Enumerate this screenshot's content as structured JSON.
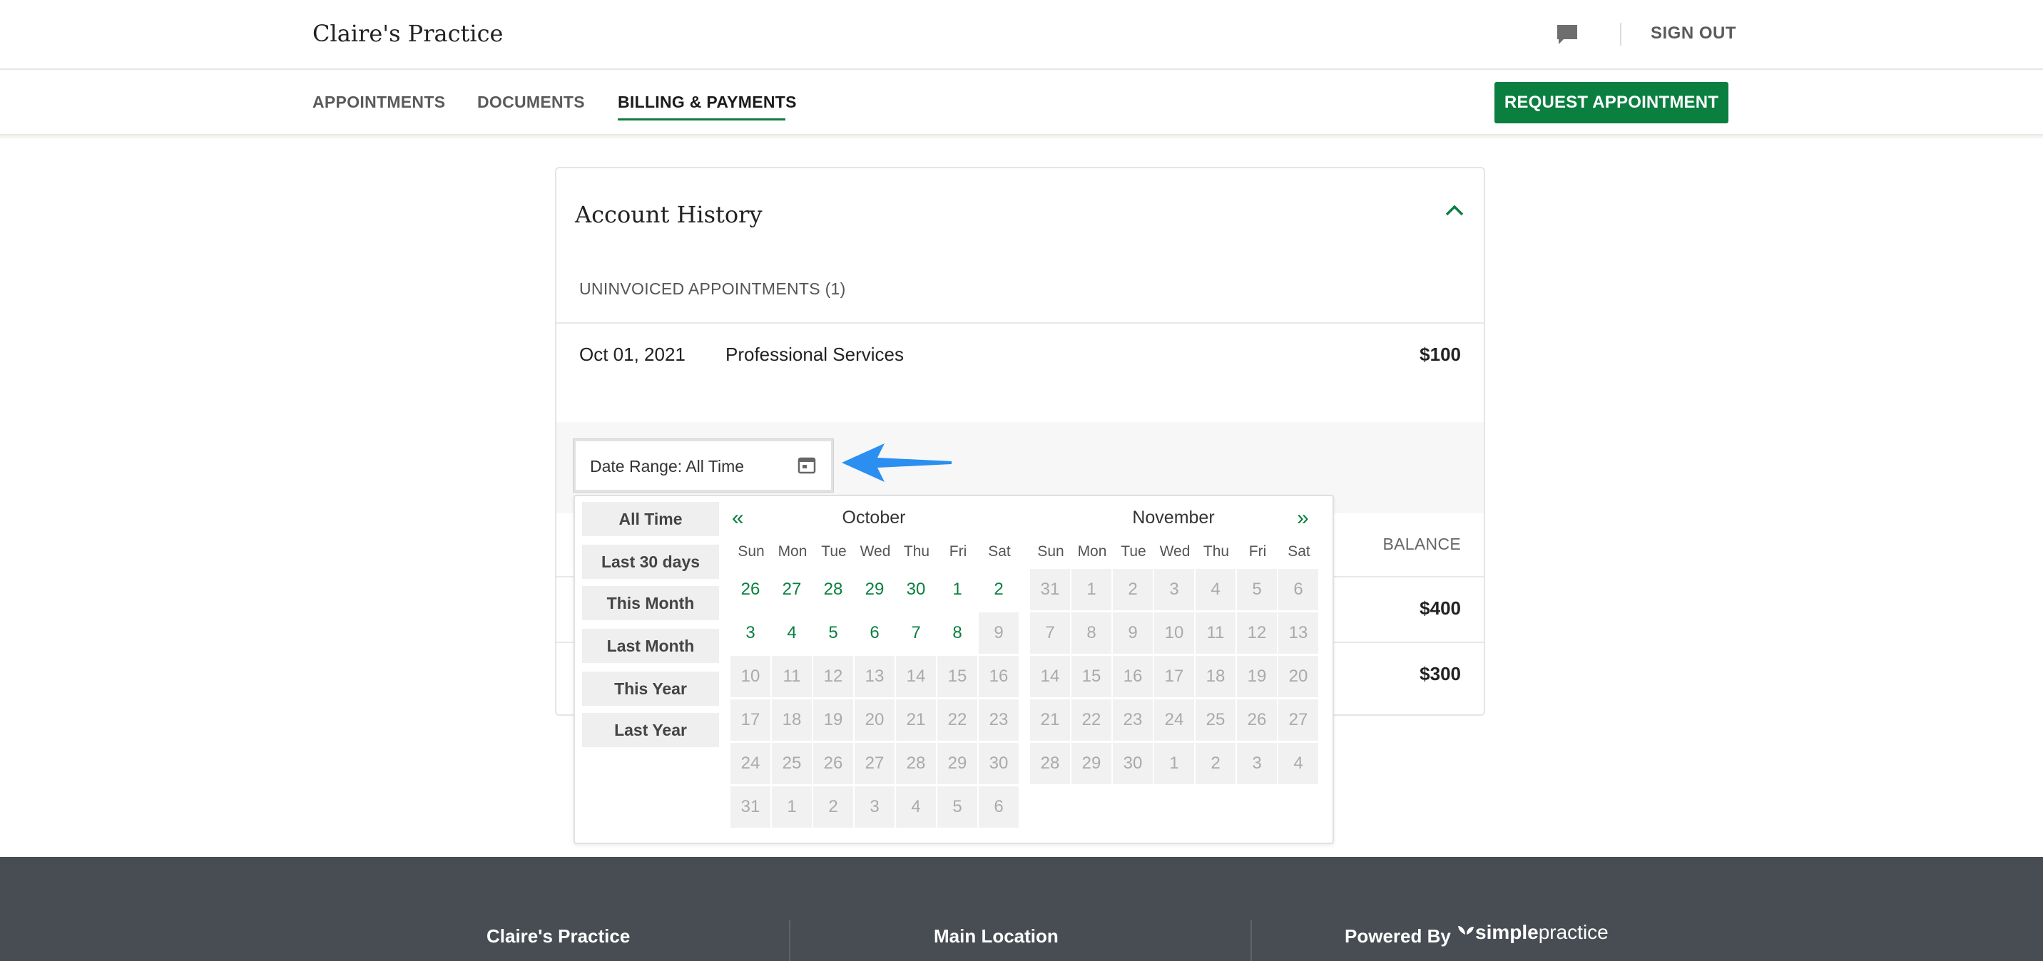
{
  "header": {
    "brand": "Claire's Practice",
    "sign_out": "SIGN OUT"
  },
  "nav": {
    "tabs": [
      {
        "label": "APPOINTMENTS",
        "active": false
      },
      {
        "label": "DOCUMENTS",
        "active": false
      },
      {
        "label": "BILLING & PAYMENTS",
        "active": true
      }
    ],
    "request_button": "REQUEST APPOINTMENT"
  },
  "account": {
    "title": "Account History",
    "uninvoiced_label": "UNINVOICED APPOINTMENTS (1)",
    "appointment": {
      "date": "Oct 01, 2021",
      "description": "Professional Services",
      "amount": "$100"
    },
    "balance_header": "BALANCE",
    "balances": [
      "$400",
      "$300"
    ]
  },
  "date_range": {
    "label": "Date Range: All Time"
  },
  "datepicker": {
    "ranges": [
      "All Time",
      "Last 30 days",
      "This Month",
      "Last Month",
      "This Year",
      "Last Year"
    ],
    "prev": "«",
    "next": "»",
    "weekdays": [
      "Sun",
      "Mon",
      "Tue",
      "Wed",
      "Thu",
      "Fri",
      "Sat"
    ],
    "months": [
      {
        "name": "October",
        "weeks": [
          [
            {
              "d": "26",
              "a": true
            },
            {
              "d": "27",
              "a": true
            },
            {
              "d": "28",
              "a": true
            },
            {
              "d": "29",
              "a": true
            },
            {
              "d": "30",
              "a": true
            },
            {
              "d": "1",
              "a": true
            },
            {
              "d": "2",
              "a": true
            }
          ],
          [
            {
              "d": "3",
              "a": true
            },
            {
              "d": "4",
              "a": true
            },
            {
              "d": "5",
              "a": true
            },
            {
              "d": "6",
              "a": true
            },
            {
              "d": "7",
              "a": true
            },
            {
              "d": "8",
              "a": true
            },
            {
              "d": "9",
              "a": false
            }
          ],
          [
            {
              "d": "10",
              "a": false
            },
            {
              "d": "11",
              "a": false
            },
            {
              "d": "12",
              "a": false
            },
            {
              "d": "13",
              "a": false
            },
            {
              "d": "14",
              "a": false
            },
            {
              "d": "15",
              "a": false
            },
            {
              "d": "16",
              "a": false
            }
          ],
          [
            {
              "d": "17",
              "a": false
            },
            {
              "d": "18",
              "a": false
            },
            {
              "d": "19",
              "a": false
            },
            {
              "d": "20",
              "a": false
            },
            {
              "d": "21",
              "a": false
            },
            {
              "d": "22",
              "a": false
            },
            {
              "d": "23",
              "a": false
            }
          ],
          [
            {
              "d": "24",
              "a": false
            },
            {
              "d": "25",
              "a": false
            },
            {
              "d": "26",
              "a": false
            },
            {
              "d": "27",
              "a": false
            },
            {
              "d": "28",
              "a": false
            },
            {
              "d": "29",
              "a": false
            },
            {
              "d": "30",
              "a": false
            }
          ],
          [
            {
              "d": "31",
              "a": false
            },
            {
              "d": "1",
              "a": false
            },
            {
              "d": "2",
              "a": false
            },
            {
              "d": "3",
              "a": false
            },
            {
              "d": "4",
              "a": false
            },
            {
              "d": "5",
              "a": false
            },
            {
              "d": "6",
              "a": false
            }
          ]
        ]
      },
      {
        "name": "November",
        "weeks": [
          [
            {
              "d": "31",
              "a": false
            },
            {
              "d": "1",
              "a": false
            },
            {
              "d": "2",
              "a": false
            },
            {
              "d": "3",
              "a": false
            },
            {
              "d": "4",
              "a": false
            },
            {
              "d": "5",
              "a": false
            },
            {
              "d": "6",
              "a": false
            }
          ],
          [
            {
              "d": "7",
              "a": false
            },
            {
              "d": "8",
              "a": false
            },
            {
              "d": "9",
              "a": false
            },
            {
              "d": "10",
              "a": false
            },
            {
              "d": "11",
              "a": false
            },
            {
              "d": "12",
              "a": false
            },
            {
              "d": "13",
              "a": false
            }
          ],
          [
            {
              "d": "14",
              "a": false
            },
            {
              "d": "15",
              "a": false
            },
            {
              "d": "16",
              "a": false
            },
            {
              "d": "17",
              "a": false
            },
            {
              "d": "18",
              "a": false
            },
            {
              "d": "19",
              "a": false
            },
            {
              "d": "20",
              "a": false
            }
          ],
          [
            {
              "d": "21",
              "a": false
            },
            {
              "d": "22",
              "a": false
            },
            {
              "d": "23",
              "a": false
            },
            {
              "d": "24",
              "a": false
            },
            {
              "d": "25",
              "a": false
            },
            {
              "d": "26",
              "a": false
            },
            {
              "d": "27",
              "a": false
            }
          ],
          [
            {
              "d": "28",
              "a": false
            },
            {
              "d": "29",
              "a": false
            },
            {
              "d": "30",
              "a": false
            },
            {
              "d": "1",
              "a": false
            },
            {
              "d": "2",
              "a": false
            },
            {
              "d": "3",
              "a": false
            },
            {
              "d": "4",
              "a": false
            }
          ]
        ]
      }
    ]
  },
  "footer": {
    "practice": "Claire's Practice",
    "location": "Main Location",
    "powered_by": "Powered By",
    "logo_bold": "simple",
    "logo_light": "practice"
  },
  "colors": {
    "accent": "#0a7f3f",
    "footer_bg": "#474d53",
    "callout_arrow": "#2a8ff0"
  },
  "icons": [
    "chat-icon",
    "chevron-up-icon",
    "calendar-icon",
    "arrow-pointer-icon",
    "butterfly-logo-icon"
  ]
}
